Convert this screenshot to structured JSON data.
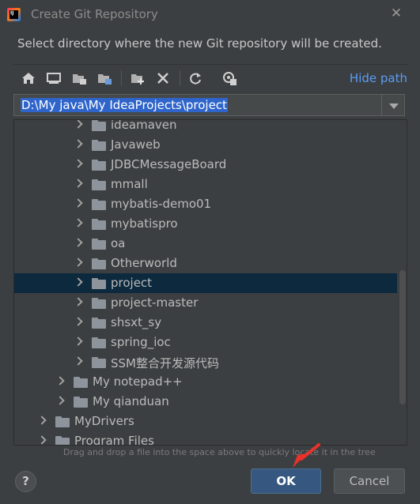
{
  "window": {
    "title": "Create Git Repository",
    "description": "Select directory where the new Git repository will be created."
  },
  "toolbar": {
    "buttons": [
      {
        "icon": "home-icon",
        "tooltip": "Home"
      },
      {
        "icon": "desktop-icon",
        "tooltip": "Desktop"
      },
      {
        "icon": "project-folder-icon",
        "tooltip": "Project"
      },
      {
        "icon": "module-folder-icon",
        "tooltip": "Module"
      },
      {
        "icon": "new-folder-icon",
        "tooltip": "New Folder"
      },
      {
        "icon": "delete-icon",
        "tooltip": "Delete"
      },
      {
        "icon": "refresh-icon",
        "tooltip": "Refresh"
      },
      {
        "icon": "show-hidden-icon",
        "tooltip": "Show Hidden Files"
      }
    ],
    "hide_path_label": "Hide path"
  },
  "path": {
    "value": "D:\\My java\\My IdeaProjects\\project"
  },
  "tree": {
    "items": [
      {
        "label": "ideamaven",
        "depth": 3,
        "selected": false
      },
      {
        "label": "Javaweb",
        "depth": 3,
        "selected": false
      },
      {
        "label": "JDBCMessageBoard",
        "depth": 3,
        "selected": false
      },
      {
        "label": "mmall",
        "depth": 3,
        "selected": false
      },
      {
        "label": "mybatis-demo01",
        "depth": 3,
        "selected": false
      },
      {
        "label": "mybatispro",
        "depth": 3,
        "selected": false
      },
      {
        "label": "oa",
        "depth": 3,
        "selected": false
      },
      {
        "label": "Otherworld",
        "depth": 3,
        "selected": false
      },
      {
        "label": "project",
        "depth": 3,
        "selected": true
      },
      {
        "label": "project-master",
        "depth": 3,
        "selected": false
      },
      {
        "label": "shsxt_sy",
        "depth": 3,
        "selected": false
      },
      {
        "label": "spring_ioc",
        "depth": 3,
        "selected": false
      },
      {
        "label": "SSM整合开发源代码",
        "depth": 3,
        "selected": false
      },
      {
        "label": "My notepad++",
        "depth": 2,
        "selected": false
      },
      {
        "label": "My qianduan",
        "depth": 2,
        "selected": false
      },
      {
        "label": "MyDrivers",
        "depth": 1,
        "selected": false
      },
      {
        "label": "Program Files",
        "depth": 1,
        "selected": false
      }
    ]
  },
  "hint": "Drag and drop a file into the space above to quickly locate it in the tree",
  "buttons": {
    "help_label": "?",
    "ok_label": "OK",
    "cancel_label": "Cancel"
  },
  "colors": {
    "background": "#3c3f41",
    "selection": "#0d293e",
    "accent_link": "#589df6",
    "ok_button": "#365880",
    "annotation_arrow": "#e8322b"
  }
}
